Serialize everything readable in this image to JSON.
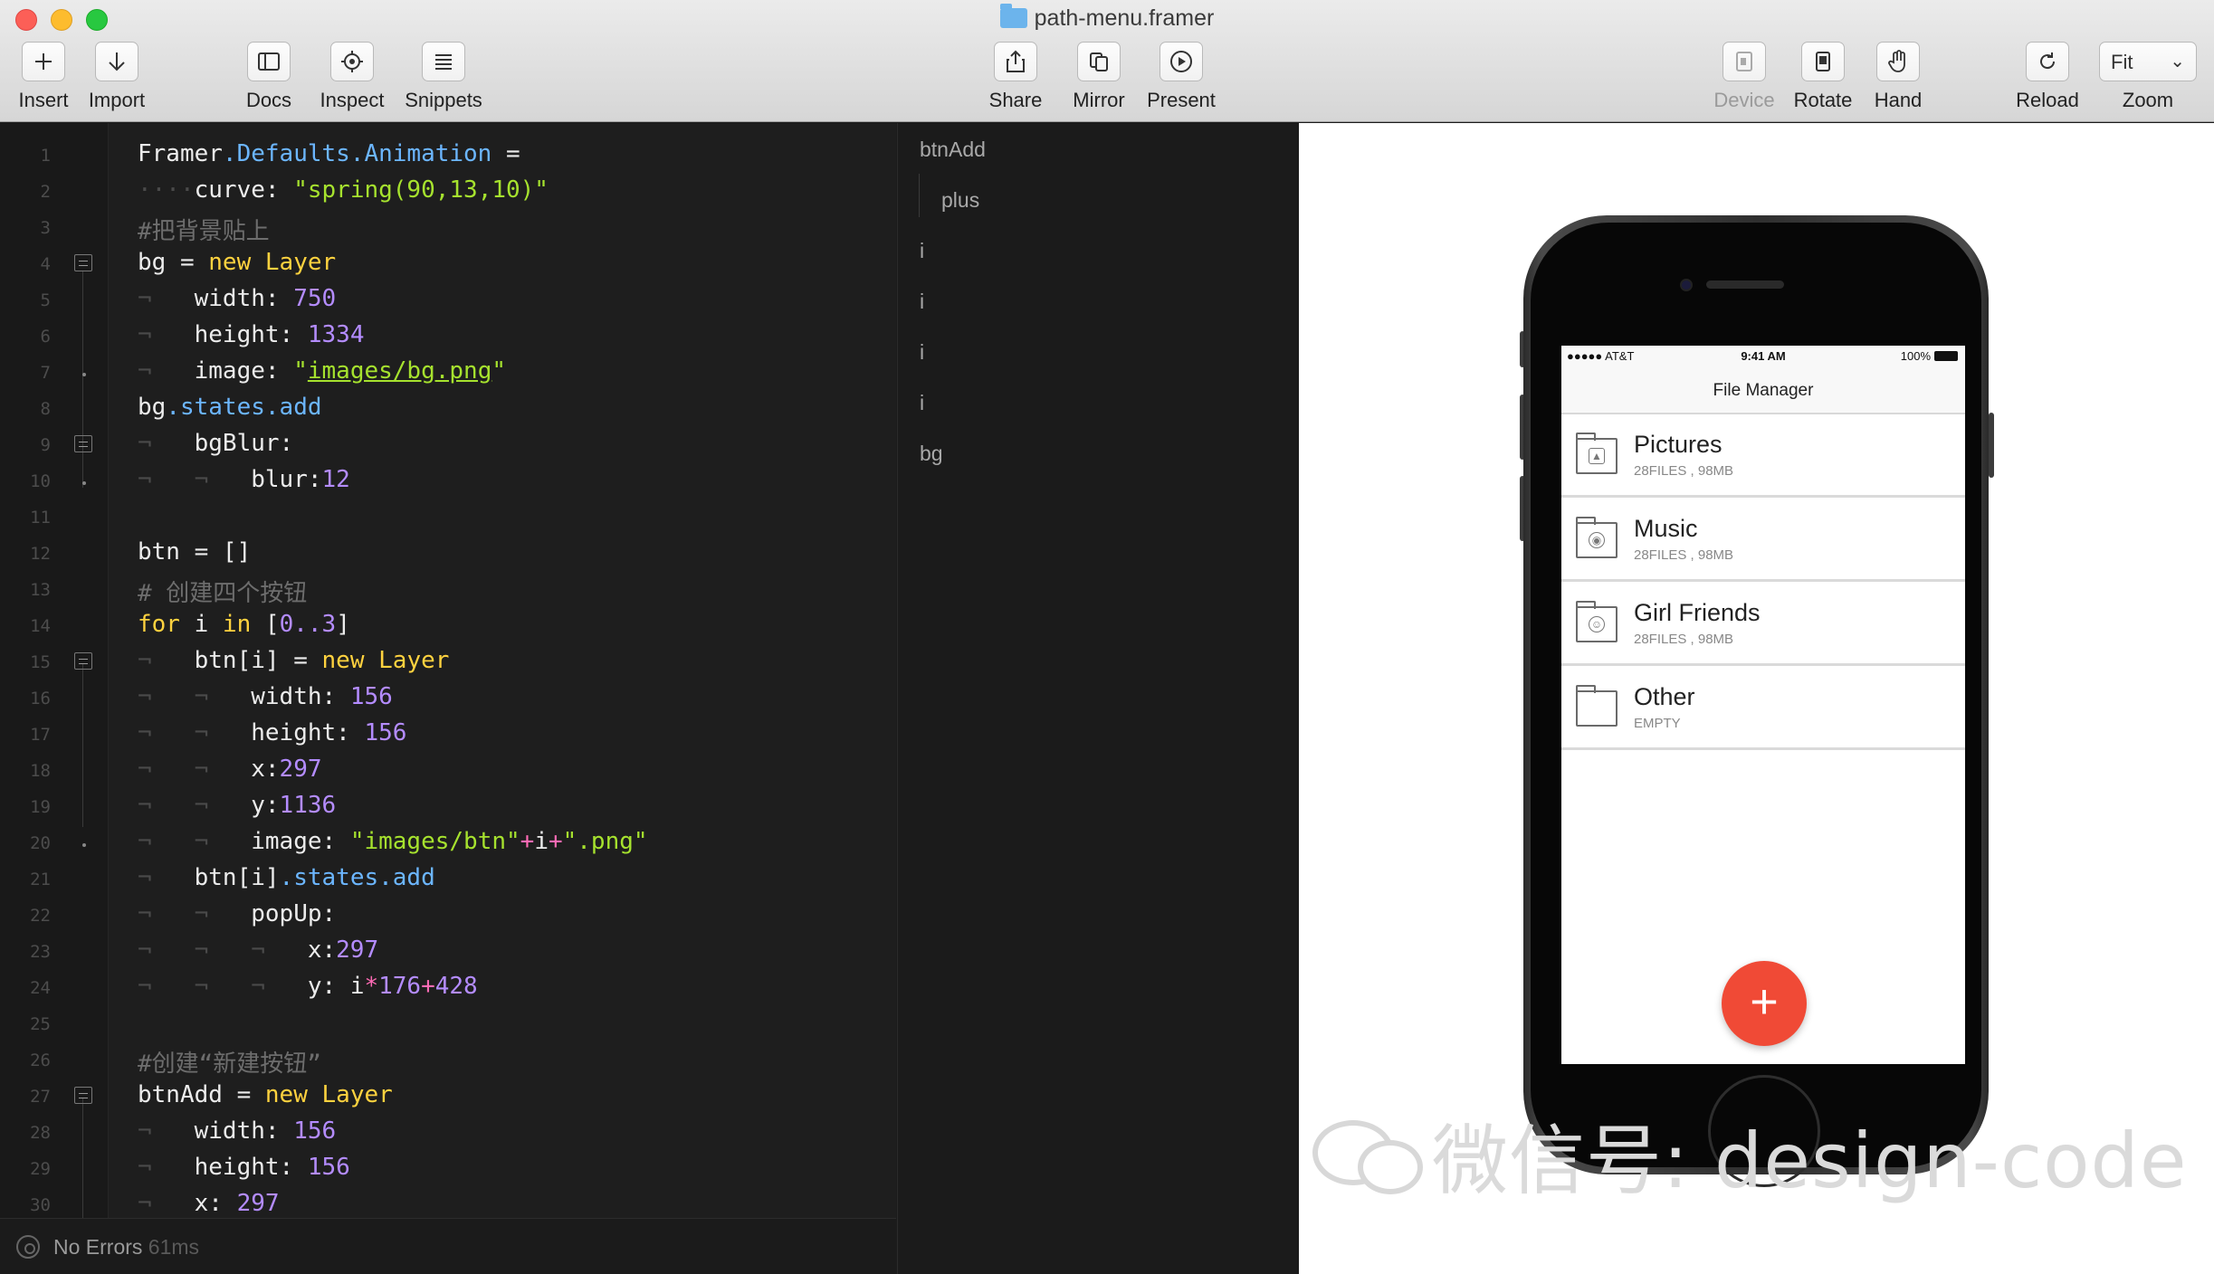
{
  "window": {
    "title": "path-menu.framer"
  },
  "toolbar": {
    "insert": "Insert",
    "import": "Import",
    "docs": "Docs",
    "inspect": "Inspect",
    "snippets": "Snippets",
    "share": "Share",
    "mirror": "Mirror",
    "present": "Present",
    "device": "Device",
    "rotate": "Rotate",
    "hand": "Hand",
    "reload": "Reload",
    "zoom_label": "Zoom",
    "zoom_value": "Fit"
  },
  "editor": {
    "line_numbers": [
      "1",
      "2",
      "3",
      "4",
      "5",
      "6",
      "7",
      "8",
      "9",
      "10",
      "11",
      "12",
      "13",
      "14",
      "15",
      "16",
      "17",
      "18",
      "19",
      "20",
      "21",
      "22",
      "23",
      "24",
      "25",
      "26",
      "27",
      "28",
      "29",
      "30"
    ],
    "lines": [
      "Framer.Defaults.Animation =",
      "curve: \"spring(90,13,10)\"",
      "#把背景贴上",
      "bg = new Layer",
      "width: 750",
      "height: 1334",
      "image: \"images/bg.png\"",
      "bg.states.add",
      "bgBlur:",
      "blur:12",
      "",
      "btn = []",
      "# 创建四个按钮",
      "for i in [0..3]",
      "btn[i] = new Layer",
      "width: 156",
      "height: 156",
      "x:297",
      "y:1136",
      "image: \"images/btn\"+i+\".png\"",
      "btn[i].states.add",
      "popUp:",
      "x:297",
      "y: i*176+428",
      "",
      "#创建“新建按钮”",
      "btnAdd = new Layer",
      "width: 156",
      "height: 156",
      "x: 297"
    ],
    "tokens": {
      "framer": "Framer",
      "defaults_anim": ".Defaults.Animation",
      "eq": " =",
      "curve": "curve: ",
      "spring": "\"spring(90,13,10)\"",
      "cmt1": "#把背景贴上",
      "bg": "bg",
      "eq2": " = ",
      "new": "new",
      "layer": " Layer",
      "width": "width: ",
      "w750": "750",
      "height": "height: ",
      "h1334": "1334",
      "image": "image: ",
      "q": "\"",
      "bgpath": "images/bg.png",
      "states_add": ".states.add",
      "bgblur": "bgBlur:",
      "blur": "blur:",
      "n12": "12",
      "btn_eq": "btn = []",
      "cmt2": "# 创建四个按钮",
      "for": "for",
      "i_": " i ",
      "in": "in",
      "lb": " [",
      "range": "0..3",
      "rb": "]",
      "btni": "btn[i]",
      "w156": "156",
      "h156": "156",
      "x": "x:",
      "x297": "297",
      "y": "y:",
      "y1136": "1136",
      "imgbtn": "\"images/btn\"",
      "plus": "+",
      "i": "i",
      "png": "\".png\"",
      "popup": "popUp:",
      "yexpr_label": "y: ",
      "star": "*",
      "n176": "176",
      "n428": "428",
      "cmt3": "#创建“新建按钮”",
      "btnadd": "btnAdd",
      "x_sp": "x: "
    }
  },
  "status": {
    "text": "No Errors",
    "time": "61ms"
  },
  "layers": {
    "items": [
      "btnAdd",
      "plus",
      "i",
      "i",
      "i",
      "i",
      "bg"
    ]
  },
  "phone": {
    "carrier": "●●●●● AT&T",
    "time": "9:41 AM",
    "battery": "100%",
    "nav_title": "File Manager",
    "folders": [
      {
        "name": "Pictures",
        "meta": "28FILES , 98MB",
        "icon": "image-icon"
      },
      {
        "name": "Music",
        "meta": "28FILES , 98MB",
        "icon": "music-icon"
      },
      {
        "name": "Girl Friends",
        "meta": "28FILES , 98MB",
        "icon": "person-icon"
      },
      {
        "name": "Other",
        "meta": "EMPTY",
        "icon": "folder-icon"
      }
    ],
    "fab_label": "+"
  },
  "watermark": {
    "text": "微信号: design-code"
  },
  "colors": {
    "accent": "#f04a36",
    "string": "#a6e22e",
    "keyword": "#ffd23f",
    "number": "#b48cff",
    "property": "#6cb6ff"
  }
}
